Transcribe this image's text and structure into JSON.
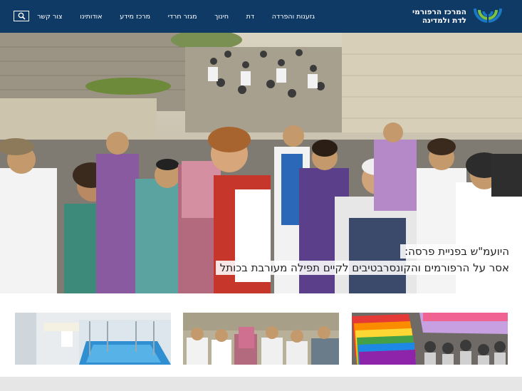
{
  "header": {
    "logo_line1": "המרכז הרפורמי",
    "logo_line2": "לדת ולמדינה",
    "nav": [
      "גזענות והפרדה",
      "דת",
      "חינוך",
      "מגזר חרדי",
      "מרכז מידע",
      "אודותינו",
      "צור קשר"
    ],
    "search_icon": "search-icon"
  },
  "hero": {
    "caption_line1": "היועמ\"ש בפניית פרסה:",
    "caption_line2": "אסר על הרפורמים והקונסרבטיבים לקיים תפילה מעורבת בכותל"
  },
  "colors": {
    "header_bg": "#0f3a66",
    "logo_blue": "#1a78c2",
    "logo_green": "#7dc242",
    "footer_bg": "#e6e6e6"
  }
}
